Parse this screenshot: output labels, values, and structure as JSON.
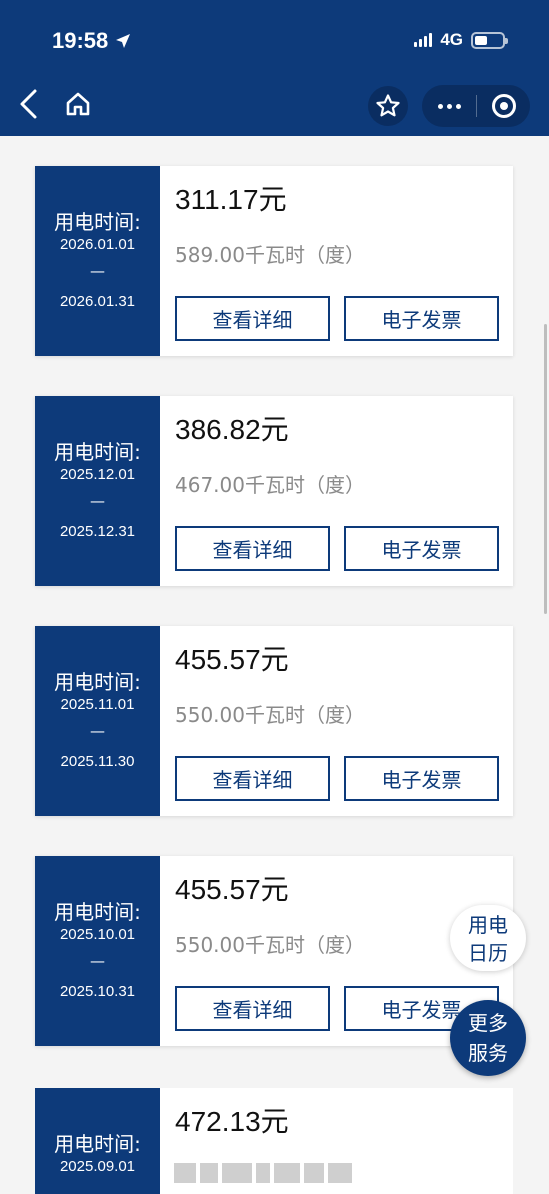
{
  "status_bar": {
    "time": "19:58",
    "network": "4G"
  },
  "nav": {
    "icons": [
      "back-icon",
      "home-icon",
      "star-icon",
      "more-icon",
      "close-icon"
    ]
  },
  "bills": [
    {
      "label": "用电时间:",
      "start": "2026.01.01",
      "dash": "—",
      "end": "2026.01.31",
      "amount": "311.17",
      "currency": "元",
      "energy": "589.00千瓦时（度）",
      "detail_btn": "查看详细",
      "invoice_btn": "电子发票"
    },
    {
      "label": "用电时间:",
      "start": "2025.12.01",
      "dash": "—",
      "end": "2025.12.31",
      "amount": "386.82",
      "currency": "元",
      "energy": "467.00千瓦时（度）",
      "detail_btn": "查看详细",
      "invoice_btn": "电子发票"
    },
    {
      "label": "用电时间:",
      "start": "2025.11.01",
      "dash": "—",
      "end": "2025.11.30",
      "amount": "455.57",
      "currency": "元",
      "energy": "550.00千瓦时（度）",
      "detail_btn": "查看详细",
      "invoice_btn": "电子发票"
    },
    {
      "label": "用电时间:",
      "start": "2025.10.01",
      "dash": "—",
      "end": "2025.10.31",
      "amount": "455.57",
      "currency": "元",
      "energy": "550.00千瓦时（度）",
      "detail_btn": "查看详细",
      "invoice_btn": "电子发票"
    },
    {
      "label": "用电时间:",
      "start": "2025.09.01",
      "amount": "472.13",
      "currency": "元"
    }
  ],
  "floating": {
    "calendar_line1": "用电",
    "calendar_line2": "日历",
    "more_line1": "更多",
    "more_line2": "服务"
  }
}
